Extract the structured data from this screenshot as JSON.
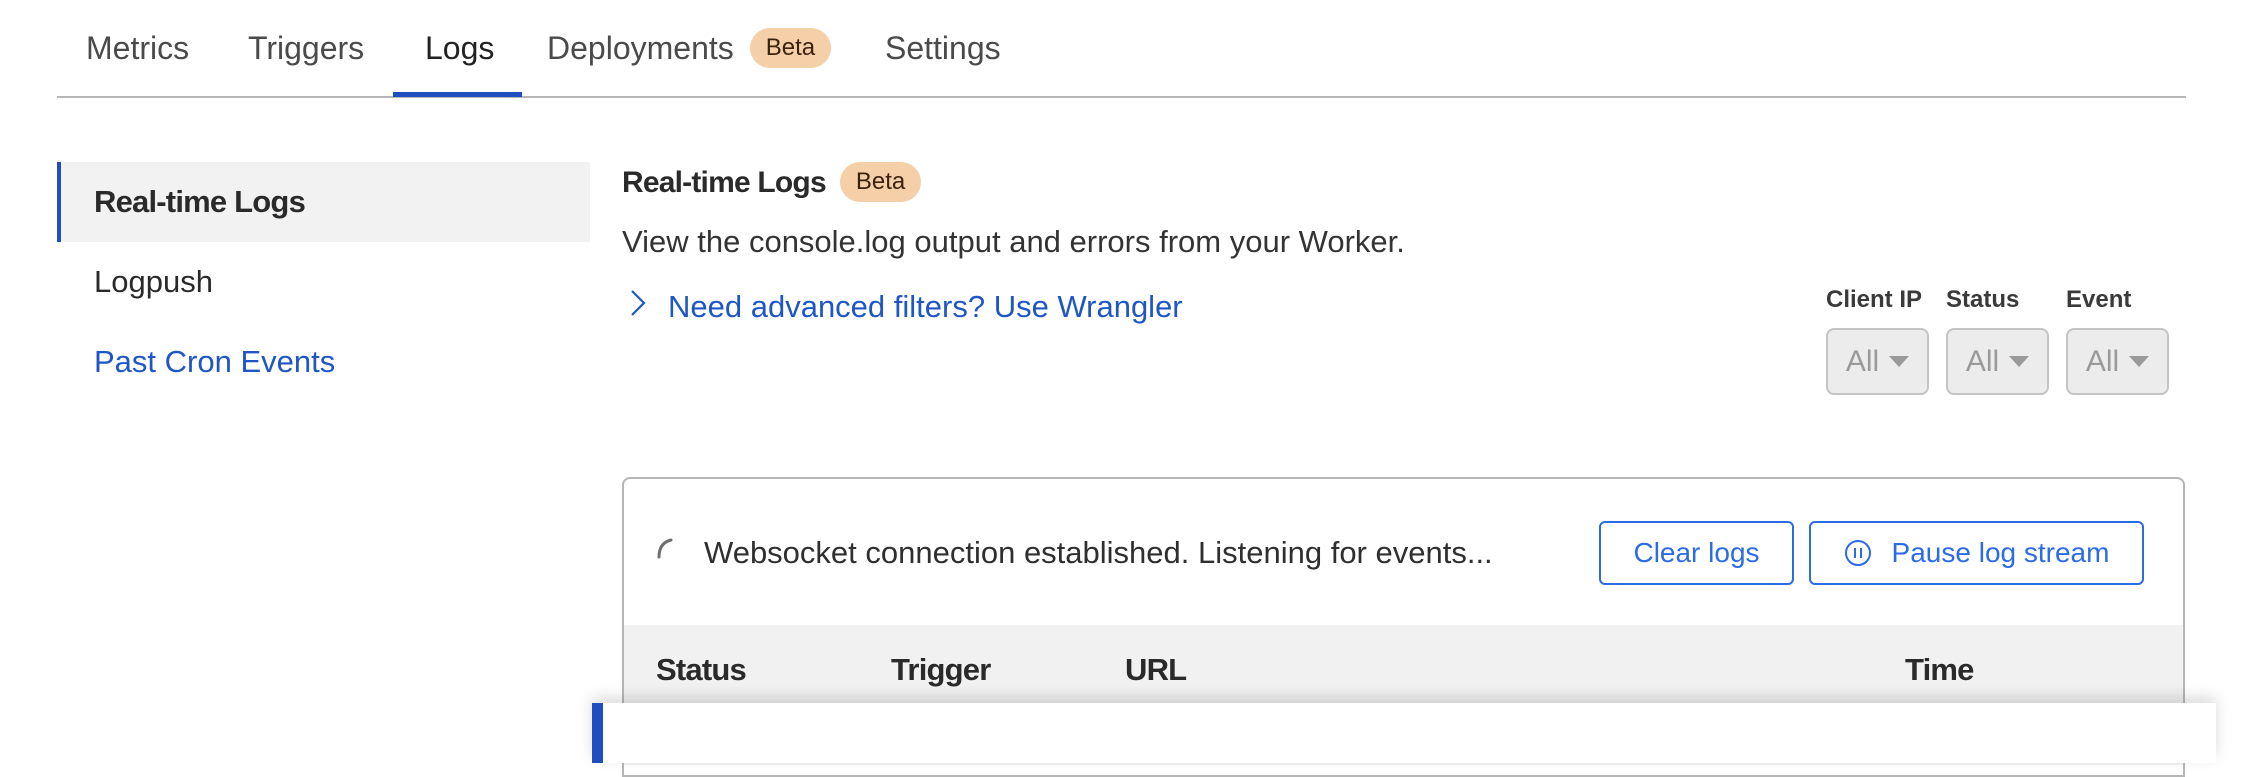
{
  "tabs": [
    {
      "label": "Metrics",
      "active": false
    },
    {
      "label": "Triggers",
      "active": false
    },
    {
      "label": "Logs",
      "active": true
    },
    {
      "label": "Deployments",
      "active": false,
      "badge": "Beta"
    },
    {
      "label": "Settings",
      "active": false
    }
  ],
  "sidebar": {
    "items": [
      {
        "label": "Real-time Logs",
        "active": true
      },
      {
        "label": "Logpush",
        "active": false
      },
      {
        "label": "Past Cron Events",
        "active": false
      }
    ]
  },
  "content": {
    "title": "Real-time Logs",
    "title_badge": "Beta",
    "description": "View the console.log output and errors from your Worker.",
    "advanced_link": "Need advanced filters? Use Wrangler",
    "advanced_link_icon": "chevron-right-icon"
  },
  "filters": [
    {
      "label": "Client IP",
      "value": "All"
    },
    {
      "label": "Status",
      "value": "All"
    },
    {
      "label": "Event",
      "value": "All"
    }
  ],
  "log_panel": {
    "status_icon": "spinner-icon",
    "status_text": "Websocket connection established. Listening for events...",
    "clear_button": "Clear logs",
    "pause_button": "Pause log stream",
    "pause_icon": "pause-circle-icon",
    "columns": [
      "Status",
      "Trigger",
      "URL",
      "Time"
    ]
  },
  "colors": {
    "accent": "#1f4fbf",
    "link": "#1f56c6",
    "button": "#2c6be6",
    "badge_bg": "#f5cfa8",
    "badge_text": "#3b220c"
  }
}
